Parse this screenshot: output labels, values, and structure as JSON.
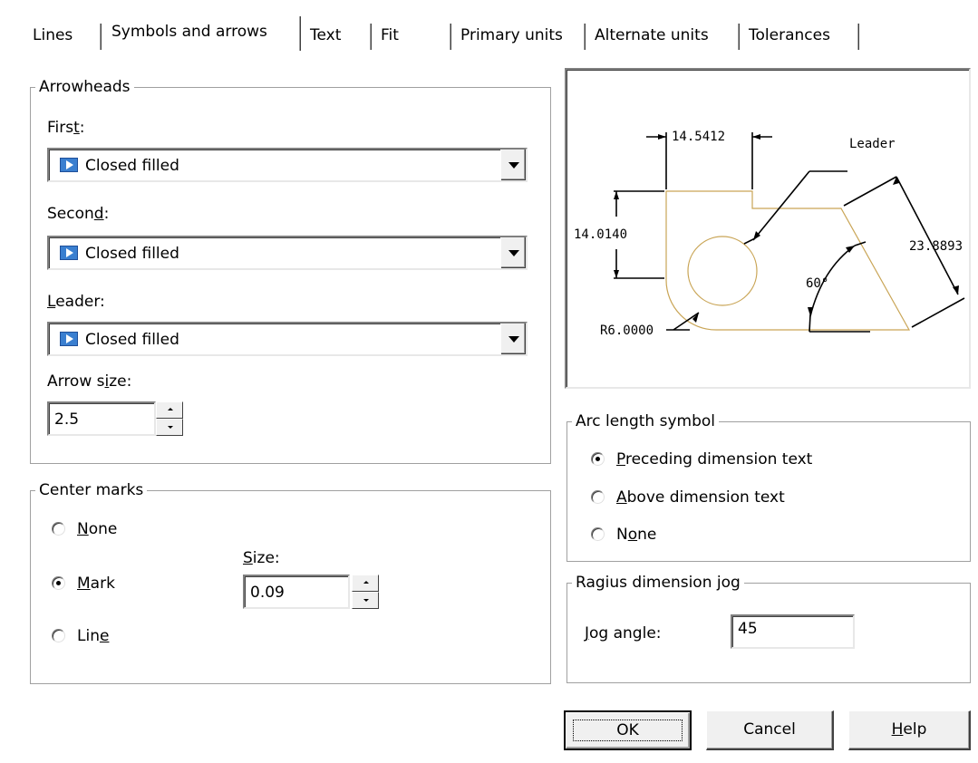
{
  "tabs": [
    {
      "label": "Lines",
      "active": false
    },
    {
      "label": "Symbols and arrows",
      "active": true
    },
    {
      "label": "Text",
      "active": false
    },
    {
      "label": "Fit",
      "active": false
    },
    {
      "label": "Primary units",
      "active": false
    },
    {
      "label": "Alternate units",
      "active": false
    },
    {
      "label": "Tolerances",
      "active": false
    }
  ],
  "arrowheads": {
    "title": "Arrowheads",
    "first": {
      "label_pre": "Firs",
      "label_u": "t",
      "label_post": ":",
      "value": "Closed filled"
    },
    "second": {
      "label_pre": "Secon",
      "label_u": "d",
      "label_post": ":",
      "value": "Closed filled"
    },
    "leader": {
      "label_pre": "",
      "label_u": "L",
      "label_post": "eader:",
      "value": "Closed filled"
    },
    "arrow_size": {
      "label_pre": "Arrow s",
      "label_u": "i",
      "label_post": "ze:",
      "value": "2.5"
    }
  },
  "center_marks": {
    "title": "Center marks",
    "none": {
      "pre": "",
      "u": "N",
      "post": "one",
      "checked": false
    },
    "mark": {
      "pre": "",
      "u": "M",
      "post": "ark",
      "checked": true
    },
    "line": {
      "pre": "Lin",
      "u": "e",
      "post": "",
      "checked": false
    },
    "size": {
      "pre": "",
      "u": "S",
      "post": "ize:",
      "value": "0.09"
    }
  },
  "preview": {
    "dim_top": "14.5412",
    "dim_left": "14.0140",
    "dim_right": "23.8893",
    "angle": "60°",
    "radius": "R6.0000",
    "leader": "Leader",
    "geometry_color": "#c9a556"
  },
  "arc_length": {
    "title": "Arc length symbol",
    "preceding": {
      "pre": "",
      "u": "P",
      "post": "receding dimension text",
      "checked": true
    },
    "above": {
      "pre": "",
      "u": "A",
      "post": "bove dimension text",
      "checked": false
    },
    "none": {
      "pre": "N",
      "u": "o",
      "post": "ne",
      "checked": false
    }
  },
  "radius_jog": {
    "title": "Ragius dimension jog",
    "jog_angle": {
      "pre": "",
      "u": "J",
      "post": "og angle:",
      "value": "45"
    }
  },
  "buttons": {
    "ok": "OK",
    "cancel": "Cancel",
    "help_u": "H",
    "help_post": "elp"
  }
}
